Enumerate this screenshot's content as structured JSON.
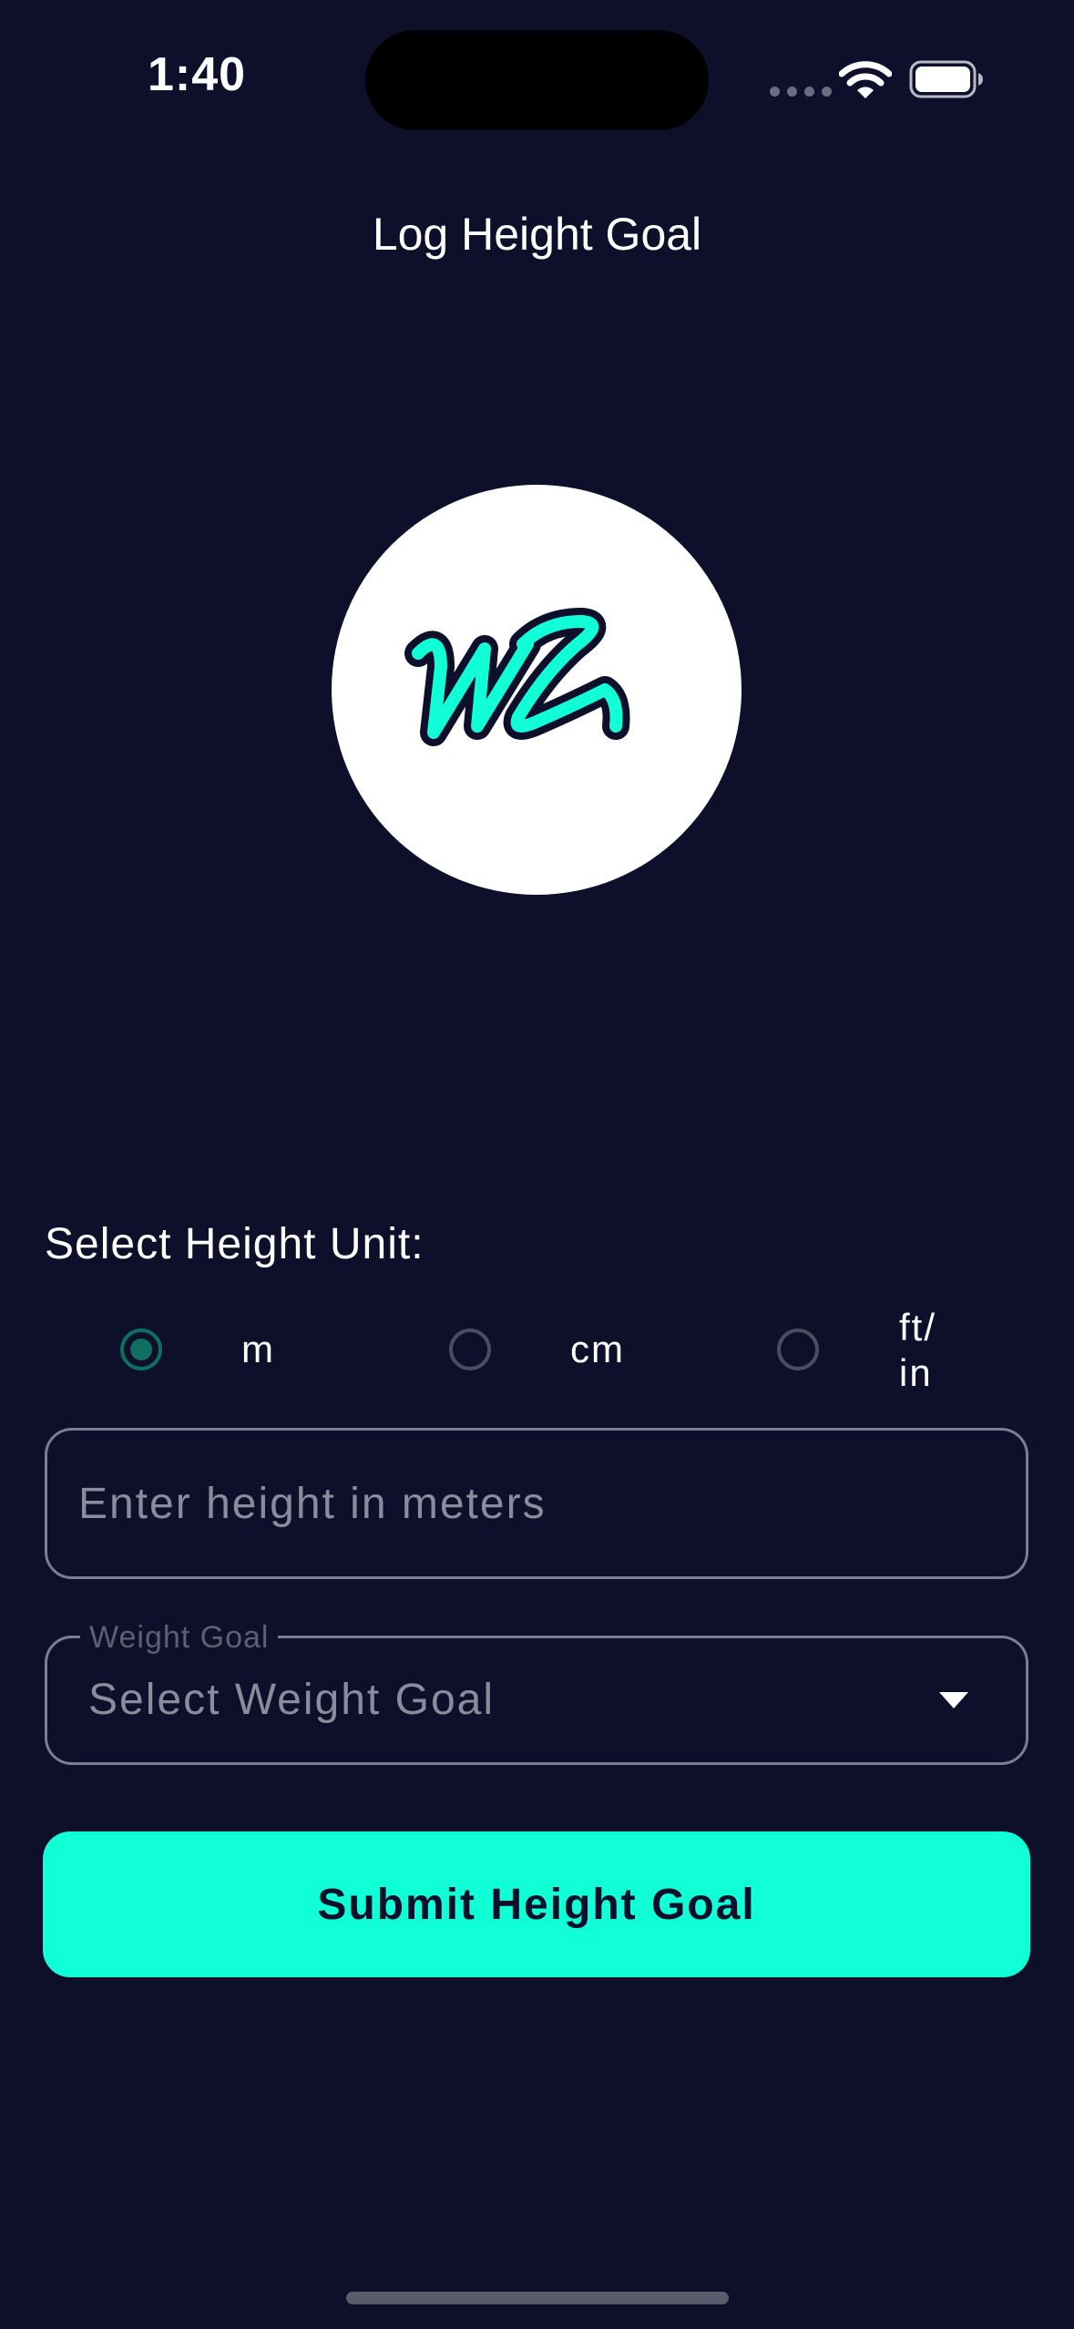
{
  "status_bar": {
    "time": "1:40"
  },
  "nav": {
    "title": "Log Height Goal"
  },
  "logo": {
    "text": "WL",
    "accent_color": "#10ffd6"
  },
  "unit_selector": {
    "label": "Select Height Unit:",
    "options": [
      {
        "label": "m",
        "selected": true
      },
      {
        "label": "cm",
        "selected": false
      },
      {
        "label": "ft/\nin",
        "selected": false
      }
    ]
  },
  "height_field": {
    "value": "",
    "placeholder": "Enter height in meters"
  },
  "weight_goal": {
    "legend": "Weight Goal",
    "value": "Select Weight Goal"
  },
  "submit": {
    "label": "Submit Height Goal"
  },
  "colors": {
    "background": "#0d0f2b",
    "accent": "#10ffd6",
    "radio_selected": "#0f6f60"
  },
  "icons": [
    "wifi-icon",
    "battery-icon",
    "chevron-down-icon"
  ]
}
